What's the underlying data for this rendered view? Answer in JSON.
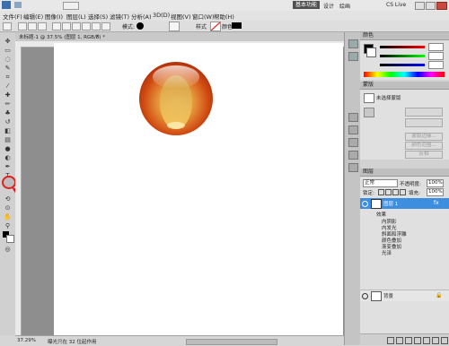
{
  "app": {
    "workspace_label": "基本功能",
    "cs_live": "CS Live"
  },
  "topbar_tabs": [
    "设计",
    "绘画"
  ],
  "menu": [
    "文件(F)",
    "编辑(E)",
    "图像(I)",
    "图层(L)",
    "选择(S)",
    "滤镜(T)",
    "分析(A)",
    "3D(D)",
    "视图(V)",
    "窗口(W)",
    "帮助(H)"
  ],
  "options": {
    "mode_label": "模式:",
    "style_label": "样式",
    "color_label": "颜色:"
  },
  "document": {
    "tab_title": "未标题-1 @ 37.5% (图层 1, RGB/8) *",
    "zoom": "37.29%",
    "status_text": "曝光只在 32 位起作用"
  },
  "panels": {
    "color_tab": "颜色",
    "swatches_tab": "色板",
    "styles_tab": "样式",
    "adjust_tab": "调整",
    "masks_tab": "蒙版",
    "mask_label": "未选择蒙版",
    "mask_buttons": [
      "蒙版边缘...",
      "颜色范围...",
      "反相"
    ],
    "layers_tab": "图层",
    "channels_tab": "通道",
    "paths_tab": "路径",
    "blend_mode": "正常",
    "opacity_label": "不透明度:",
    "opacity_value": "100%",
    "lock_label": "锁定:",
    "fill_label": "填充:",
    "fill_value": "100%",
    "layer1": "图层 1",
    "effects_label": "效果",
    "effects": [
      "内阴影",
      "内发光",
      "斜面和浮雕",
      "颜色叠加",
      "渐变叠加",
      "光泽"
    ],
    "background_layer": "背景"
  },
  "colors": {
    "accent": "#3d8ede",
    "highlight_red": "#e11e1e"
  }
}
